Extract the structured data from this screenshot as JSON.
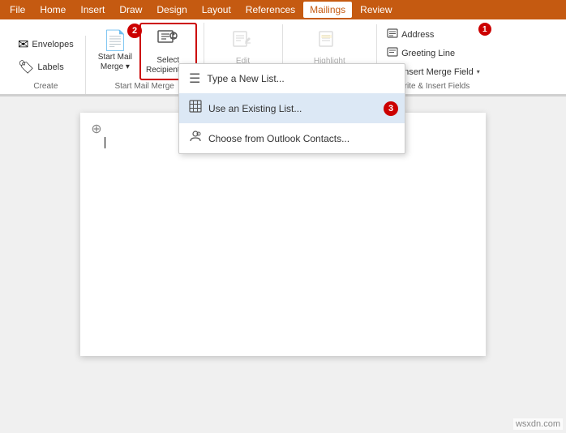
{
  "menuBar": {
    "items": [
      "File",
      "Home",
      "Insert",
      "Draw",
      "Design",
      "Layout",
      "References",
      "Mailings",
      "Review"
    ]
  },
  "activeTab": "Mailings",
  "groups": [
    {
      "id": "create",
      "label": "Create",
      "buttons": [
        {
          "id": "envelopes",
          "icon": "✉",
          "label": "Envelopes",
          "small": true
        },
        {
          "id": "labels",
          "icon": "🏷",
          "label": "Labels",
          "small": true
        }
      ]
    },
    {
      "id": "startMailMerge",
      "label": "Start Mail Merge",
      "buttons": [
        {
          "id": "startMailMerge",
          "icon": "📄",
          "label": "Start Mail\nMerge",
          "arrow": true,
          "badge": null
        },
        {
          "id": "selectRecipients",
          "icon": "👥",
          "label": "Select\nRecipients",
          "arrow": true,
          "badge": "2",
          "highlighted": true
        }
      ]
    },
    {
      "id": "editRecipientList",
      "label": "Edit Recipient List",
      "buttons": [
        {
          "id": "editRecipientList",
          "icon": "✏️",
          "label": "Edit\nRecipient List",
          "disabled": true
        }
      ]
    },
    {
      "id": "highlightMergeFields",
      "label": "Highlight Merge Fields",
      "buttons": [
        {
          "id": "highlightMergeFields",
          "icon": "🖊",
          "label": "Highlight\nMerge Fields",
          "disabled": true
        }
      ]
    },
    {
      "id": "writeInsertFields",
      "label": "Write & Insert Fields",
      "items": [
        {
          "id": "address",
          "icon": "📝",
          "label": "Address",
          "badge": "1"
        },
        {
          "id": "greetingLine",
          "icon": "📝",
          "label": "Greeting Line"
        },
        {
          "id": "insertMergeField",
          "icon": "📝",
          "label": "Insert Merge Field",
          "arrow": true
        }
      ]
    }
  ],
  "dropdown": {
    "items": [
      {
        "id": "typeNewList",
        "icon": "☰",
        "label": "Type a New List..."
      },
      {
        "id": "useExistingList",
        "icon": "▦",
        "label": "Use an Existing List...",
        "selected": true,
        "badge": "3"
      },
      {
        "id": "chooseOutlook",
        "icon": "👤",
        "label": "Choose from Outlook Contacts..."
      }
    ]
  },
  "badges": {
    "badge1": "1",
    "badge2": "2",
    "badge3": "3"
  },
  "watermark": "wsxdn.com"
}
